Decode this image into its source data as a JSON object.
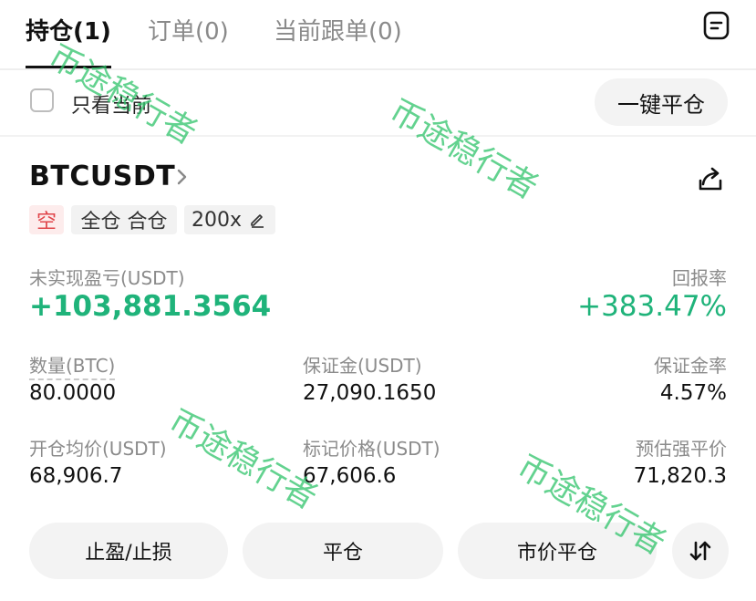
{
  "tabs": [
    {
      "label": "持仓(1)"
    },
    {
      "label": "订单(0)"
    },
    {
      "label": "当前跟单(0)"
    }
  ],
  "filter": {
    "only_current_label": "只看当前"
  },
  "close_all_label": "一键平仓",
  "position": {
    "symbol": "BTCUSDT",
    "side_tag": "空",
    "margin_mode_tag": "全仓 合仓",
    "leverage_tag": "200x",
    "unrealized_pnl_label": "未实现盈亏(USDT)",
    "unrealized_pnl_value": "+103,881.3564",
    "roe_label": "回报率",
    "roe_value": "+383.47%",
    "qty_label": "数量(BTC)",
    "qty_value": "80.0000",
    "margin_label": "保证金(USDT)",
    "margin_value": "27,090.1650",
    "margin_ratio_label": "保证金率",
    "margin_ratio_value": "4.57%",
    "entry_label": "开仓均价(USDT)",
    "entry_value": "68,906.7",
    "mark_label": "标记价格(USDT)",
    "mark_value": "67,606.6",
    "liq_label": "预估强平价",
    "liq_value": "71,820.3"
  },
  "actions": {
    "tpsl_label": "止盈/止损",
    "close_label": "平仓",
    "market_close_label": "市价平仓"
  },
  "watermark_text": "币途稳行者",
  "colors": {
    "profit_green": "#1fb37a",
    "short_red": "#e0454a",
    "watermark_green": "#2fc36a"
  }
}
